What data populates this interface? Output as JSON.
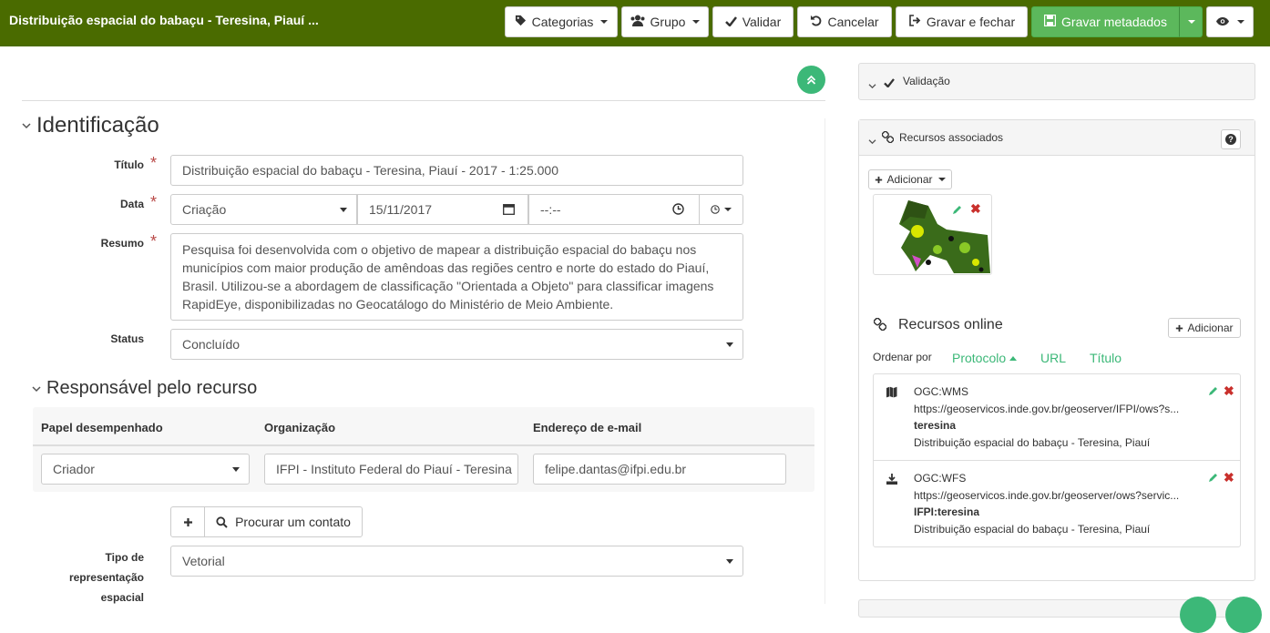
{
  "header": {
    "title": "Distribuição espacial do babaçu - Teresina, Piauí ...",
    "buttons": {
      "categorias": "Categorias",
      "grupo": "Grupo",
      "validar": "Validar",
      "cancelar": "Cancelar",
      "gravar_fechar": "Gravar e fechar",
      "gravar_metadados": "Gravar metadados"
    }
  },
  "identificacao": {
    "title": "Identificação",
    "titulo_label": "Título",
    "titulo_value": "Distribuição espacial do babaçu - Teresina, Piauí - 2017 - 1:25.000",
    "data_label": "Data",
    "data_type": "Criação",
    "data_date": "15/11/2017",
    "data_time": "--:--",
    "resumo_label": "Resumo",
    "resumo_value": "Pesquisa foi desenvolvida com o objetivo de mapear a distribuição espacial do babaçu nos municípios com maior produção de amêndoas das regiões centro e norte do estado do Piauí, Brasil. Utilizou-se a abordagem de classificação \"Orientada a Objeto\" para classificar imagens RapidEye, disponibilizadas no Geocatálogo do Ministério de Meio Ambiente.",
    "status_label": "Status",
    "status_value": "Concluído"
  },
  "responsavel": {
    "title": "Responsável pelo recurso",
    "col_papel": "Papel desempenhado",
    "col_org": "Organização",
    "col_email": "Endereço de e-mail",
    "papel_value": "Criador",
    "org_value": "IFPI - Instituto Federal do Piauí - Teresina",
    "email_value": "felipe.dantas@ifpi.edu.br",
    "procurar_label": "Procurar um contato"
  },
  "tipo": {
    "label_lines": [
      "Tipo de",
      "representação",
      "espacial"
    ],
    "value": "Vetorial"
  },
  "sidebar": {
    "validacao": "Validação",
    "recursos_associados": "Recursos associados",
    "adicionar": "Adicionar",
    "recursos_online": "Recursos online",
    "adicionar2": "Adicionar",
    "ordenar_por": "Ordenar por",
    "sort": [
      "Protocolo",
      "URL",
      "Título"
    ],
    "resources": [
      {
        "protocol": "OGC:WMS",
        "url": "https://geoservicos.inde.gov.br/geoserver/IFPI/ows?s...",
        "name": "teresina",
        "desc": "Distribuição espacial do babaçu - Teresina, Piauí",
        "icon": "map-icon"
      },
      {
        "protocol": "OGC:WFS",
        "url": "https://geoservicos.inde.gov.br/geoserver/ows?servic...",
        "name": "IFPI:teresina",
        "desc": "Distribuição espacial do babaçu - Teresina, Piauí",
        "icon": "download-icon"
      }
    ]
  },
  "colors": {
    "topbar": "#4a6b00",
    "accent": "#3cb878",
    "primary_btn": "#5cb85c",
    "danger": "#c9302c"
  }
}
